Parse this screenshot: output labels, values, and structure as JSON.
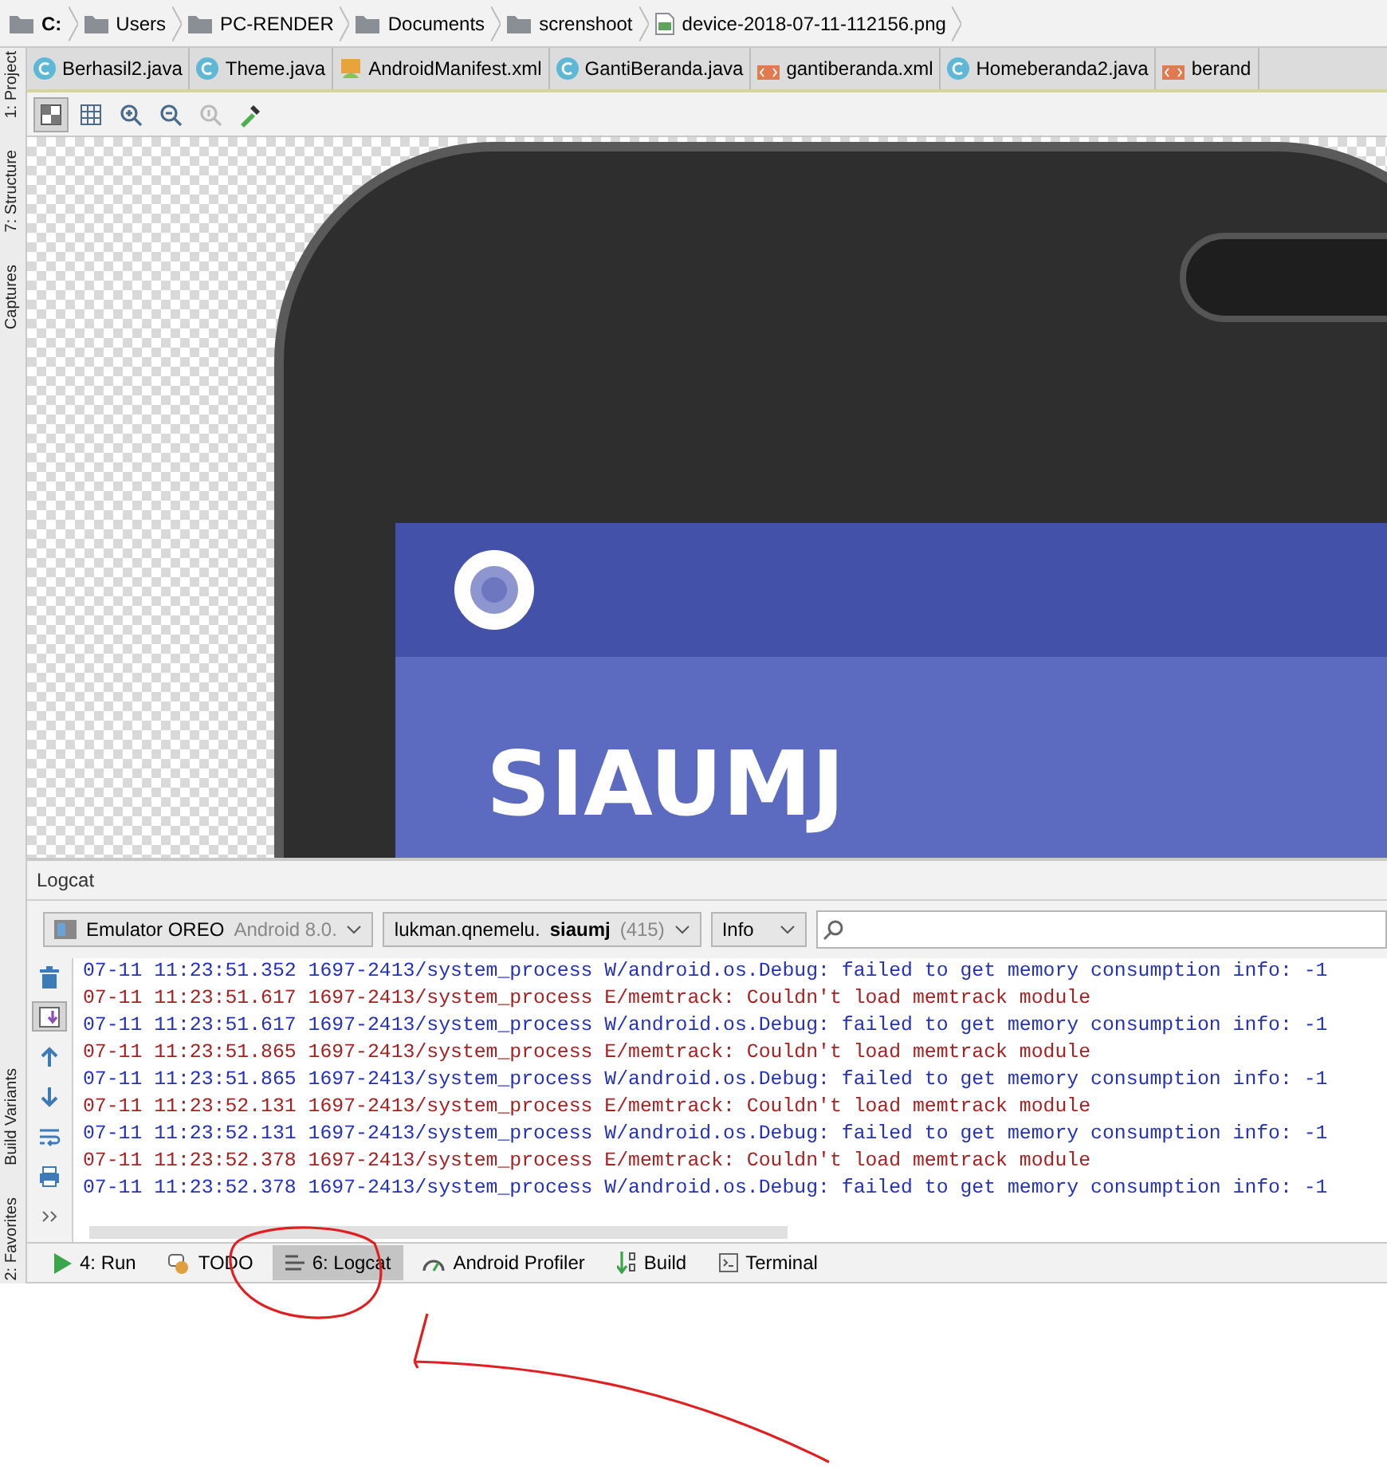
{
  "breadcrumbs": [
    {
      "label": "C:",
      "kind": "drive"
    },
    {
      "label": "Users",
      "kind": "folder"
    },
    {
      "label": "PC-RENDER",
      "kind": "folder"
    },
    {
      "label": "Documents",
      "kind": "folder"
    },
    {
      "label": "screnshoot",
      "kind": "folder"
    },
    {
      "label": "device-2018-07-11-112156.png",
      "kind": "image"
    }
  ],
  "side_tools_top": [
    "1: Project",
    "7: Structure",
    "Captures"
  ],
  "side_tools_bottom": [
    "Build Variants",
    "2: Favorites"
  ],
  "editor_tabs": [
    {
      "label": "Berhasil2.java",
      "kind": "java"
    },
    {
      "label": "Theme.java",
      "kind": "java"
    },
    {
      "label": "AndroidManifest.xml",
      "kind": "manifest"
    },
    {
      "label": "GantiBeranda.java",
      "kind": "java"
    },
    {
      "label": "gantiberanda.xml",
      "kind": "xml"
    },
    {
      "label": "Homeberanda2.java",
      "kind": "java"
    },
    {
      "label": "berand",
      "kind": "xml"
    }
  ],
  "image_toolbar": [
    {
      "kind": "checker",
      "selected": true
    },
    {
      "kind": "grid",
      "selected": false
    },
    {
      "kind": "zoom-in",
      "selected": false
    },
    {
      "kind": "zoom-out",
      "selected": false
    },
    {
      "kind": "actual",
      "selected": false
    },
    {
      "kind": "picker",
      "selected": false
    }
  ],
  "preview": {
    "app_title": "SIAUMJ"
  },
  "logcat": {
    "title": "Logcat",
    "device": {
      "name": "Emulator OREO",
      "detail": "Android 8.0."
    },
    "process": {
      "name": "lukman.qnemelu.**siaumj**",
      "pid": "(415)"
    },
    "log_level": "Info",
    "actions": [
      {
        "kind": "trash",
        "selected": false
      },
      {
        "kind": "scroll-end",
        "selected": true
      },
      {
        "kind": "up",
        "selected": false
      },
      {
        "kind": "down",
        "selected": false
      },
      {
        "kind": "wrap",
        "selected": false
      },
      {
        "kind": "print",
        "selected": false
      },
      {
        "kind": "more",
        "selected": false
      }
    ],
    "lines": [
      {
        "text": "07-11 11:23:51.352 1697-2413/system_process W/android.os.Debug: failed to get memory consumption info: -1",
        "kind": "warning"
      },
      {
        "text": "07-11 11:23:51.617 1697-2413/system_process E/memtrack: Couldn't load memtrack module",
        "kind": "error"
      },
      {
        "text": "07-11 11:23:51.617 1697-2413/system_process W/android.os.Debug: failed to get memory consumption info: -1",
        "kind": "warning"
      },
      {
        "text": "07-11 11:23:51.865 1697-2413/system_process E/memtrack: Couldn't load memtrack module",
        "kind": "error"
      },
      {
        "text": "07-11 11:23:51.865 1697-2413/system_process W/android.os.Debug: failed to get memory consumption info: -1",
        "kind": "warning"
      },
      {
        "text": "07-11 11:23:52.131 1697-2413/system_process E/memtrack: Couldn't load memtrack module",
        "kind": "error"
      },
      {
        "text": "07-11 11:23:52.131 1697-2413/system_process W/android.os.Debug: failed to get memory consumption info: -1",
        "kind": "warning"
      },
      {
        "text": "07-11 11:23:52.378 1697-2413/system_process E/memtrack: Couldn't load memtrack module",
        "kind": "error"
      },
      {
        "text": "07-11 11:23:52.378 1697-2413/system_process W/android.os.Debug: failed to get memory consumption info: -1",
        "kind": "warning"
      }
    ]
  },
  "bottom_tools": [
    {
      "label": "4: Run",
      "kind": "run",
      "selected": false
    },
    {
      "label": "TODO",
      "kind": "todo",
      "selected": false
    },
    {
      "label": "6: Logcat",
      "kind": "logcat",
      "selected": true
    },
    {
      "label": "Android Profiler",
      "kind": "profiler",
      "selected": false
    },
    {
      "label": "Build",
      "kind": "build",
      "selected": false
    },
    {
      "label": "Terminal",
      "kind": "terminal",
      "selected": false
    }
  ]
}
